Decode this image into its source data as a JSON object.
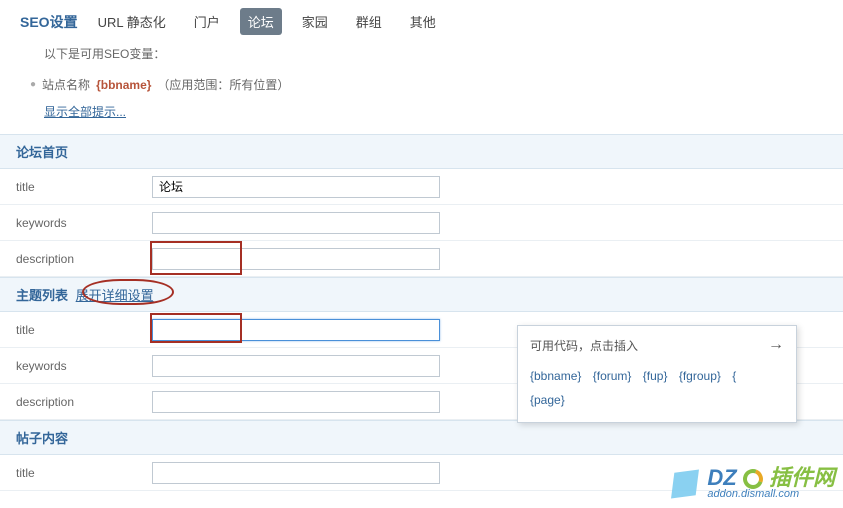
{
  "tabs": {
    "primary": "SEO设置",
    "items": [
      "URL 静态化",
      "门户",
      "论坛",
      "家园",
      "群组",
      "其他"
    ],
    "active_index": 2
  },
  "instructions": {
    "intro": "以下是可用SEO变量：",
    "var_label": "站点名称",
    "var_code": "{bbname}",
    "var_scope": "（应用范围：所有位置）",
    "show_all": "显示全部提示..."
  },
  "sections": [
    {
      "title": "论坛首页",
      "rows": [
        {
          "label": "title",
          "value": "论坛"
        },
        {
          "label": "keywords",
          "value": ""
        },
        {
          "label": "description",
          "value": ""
        }
      ]
    },
    {
      "title": "主题列表",
      "expand": "展开详细设置",
      "rows": [
        {
          "label": "title",
          "value": "",
          "focused": true
        },
        {
          "label": "keywords",
          "value": ""
        },
        {
          "label": "description",
          "value": ""
        }
      ]
    },
    {
      "title": "帖子内容",
      "rows": [
        {
          "label": "title",
          "value": ""
        }
      ]
    }
  ],
  "tooltip": {
    "head": "可用代码，点击插入",
    "arrow": "→",
    "codes": [
      "{bbname}",
      "{forum}",
      "{fup}",
      "{fgroup}",
      "{page}"
    ],
    "sep": "{"
  },
  "watermark": {
    "brand": "DZ",
    "cn": "插件网",
    "domain": "addon.dismall.com"
  }
}
